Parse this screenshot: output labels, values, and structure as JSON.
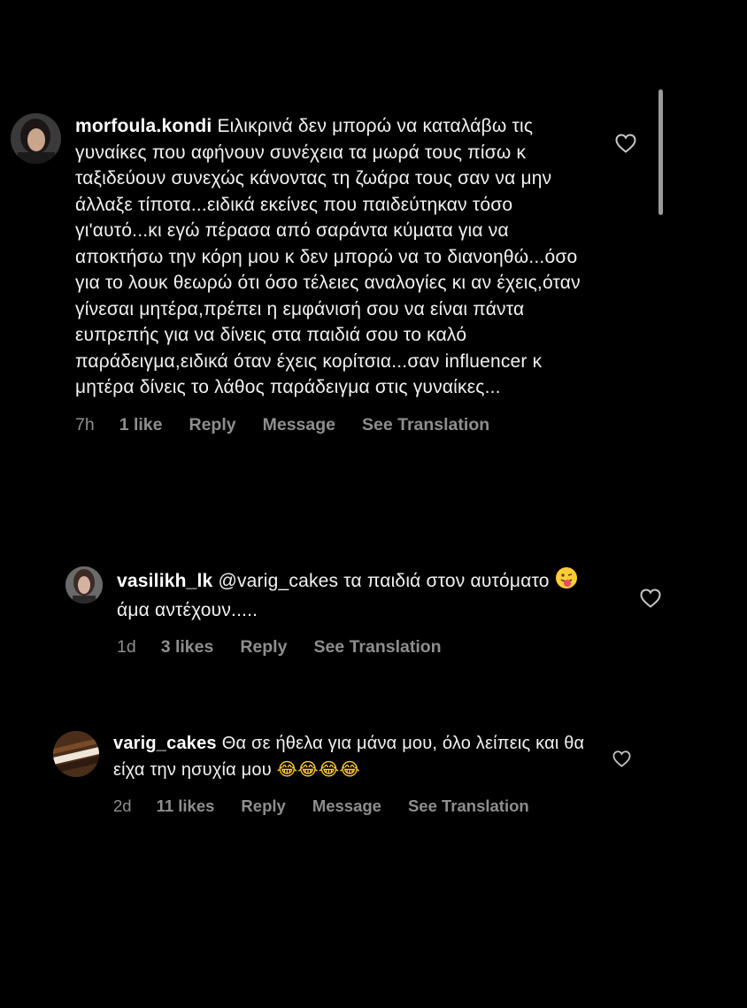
{
  "comments": [
    {
      "username": "morfoula.kondi",
      "text": "Ειλικρινά δεν μπορώ να καταλάβω τις γυναίκες που αφήνουν συνέχεια τα μωρά τους πίσω κ ταξιδεύουν συνεχώς κάνοντας τη ζωάρα τους σαν να μην άλλαξε τίποτα...ειδικά εκείνες που παιδεύτηκαν τόσο γι'αυτό...κι εγώ πέρασα από σαράντα κύματα για να αποκτήσω την κόρη μου κ δεν μπορώ να το διανοηθώ...όσο για το λουκ θεωρώ ότι όσο τέλειες αναλογίες κι αν έχεις,όταν γίνεσαι μητέρα,πρέπει η εμφάνισή σου να είναι πάντα ευπρεπής για να δίνεις στα παιδιά σου το καλό παράδειγμα,ειδικά όταν έχεις κορίτσια...σαν influencer κ μητέρα δίνεις το λάθος παράδειγμα στις γυναίκες...",
      "time": "7h",
      "likes": "1 like",
      "reply": "Reply",
      "message": "Message",
      "translate": "See Translation"
    },
    {
      "username": "vasilikh_lk",
      "text_before_emoji": "@varig_cakes τα παιδιά στον αυτόματο",
      "emoji": "😛",
      "text_after_emoji": "άμα αντέχουν.....",
      "time": "1d",
      "likes": "3 likes",
      "reply": "Reply",
      "translate": "See Translation"
    },
    {
      "username": "varig_cakes",
      "text": "Θα σε ήθελα για μάνα μου, όλο λείπεις και θα είχα την ησυχία μου",
      "emojis": "😂😂😂😂",
      "time": "2d",
      "likes": "11 likes",
      "reply": "Reply",
      "message": "Message",
      "translate": "See Translation"
    }
  ],
  "icons": {
    "like": "heart-outline-icon"
  },
  "colors": {
    "background": "#000000",
    "text": "#f2f2f2",
    "meta": "#8e8e8e"
  }
}
